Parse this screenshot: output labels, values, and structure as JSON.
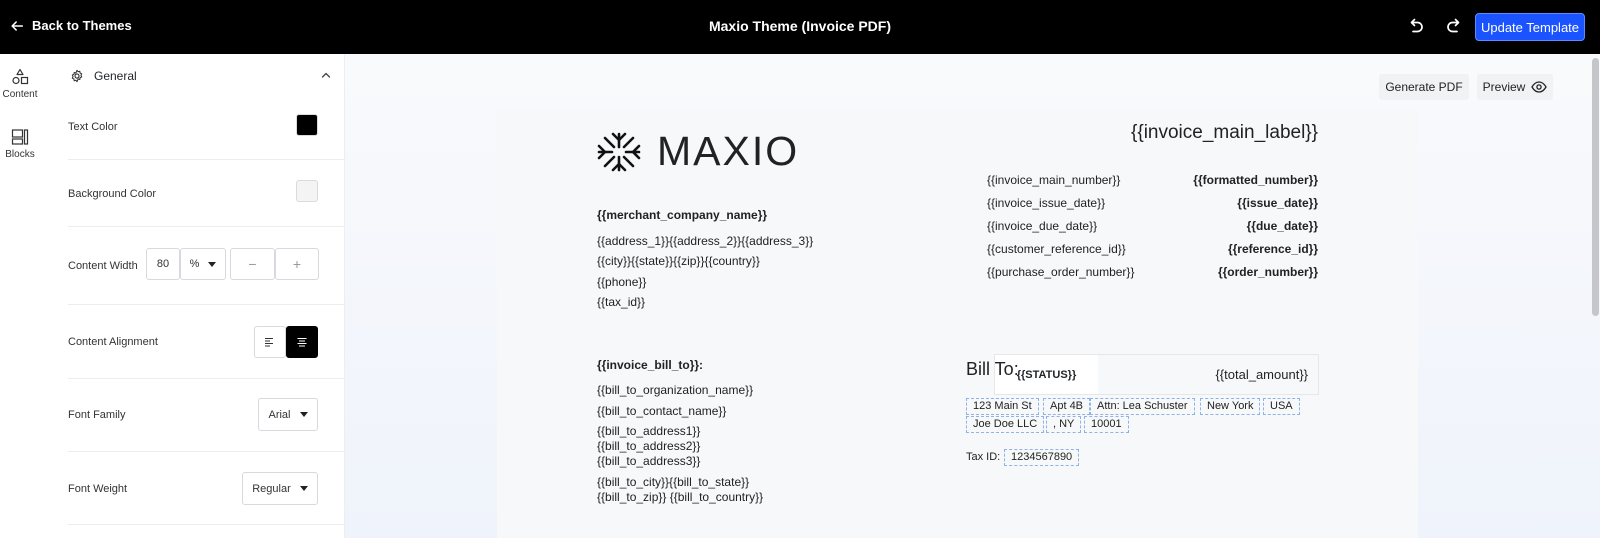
{
  "topbar": {
    "back_label": "Back to Themes",
    "title": "Maxio Theme (Invoice PDF)",
    "update_label": "Update Template"
  },
  "rail": {
    "items": [
      {
        "label": "Content",
        "icon": "shapes-icon"
      },
      {
        "label": "Blocks",
        "icon": "blocks-icon"
      }
    ]
  },
  "panel": {
    "section_title": "General",
    "text_color": {
      "label": "Text Color",
      "value": "#000000"
    },
    "background_color": {
      "label": "Background Color",
      "value": "#f4f4f5"
    },
    "content_width": {
      "label": "Content Width",
      "value": "80",
      "unit": "%",
      "minus": "−",
      "plus": "+"
    },
    "content_alignment": {
      "label": "Content Alignment",
      "selected": "center"
    },
    "font_family": {
      "label": "Font Family",
      "value": "Arial"
    },
    "font_weight": {
      "label": "Font Weight",
      "value": "Regular"
    }
  },
  "canvas": {
    "generate_label": "Generate PDF",
    "preview_label": "Preview"
  },
  "invoice": {
    "logo_text": "MAXIO",
    "main_label": "{{invoice_main_label}}",
    "meta": [
      {
        "label": "{{invoice_main_number}}",
        "value": "{{formatted_number}}"
      },
      {
        "label": "{{invoice_issue_date}}",
        "value": "{{issue_date}}"
      },
      {
        "label": "{{invoice_due_date}}",
        "value": "{{due_date}}"
      },
      {
        "label": "{{customer_reference_id}}",
        "value": "{{reference_id}}"
      },
      {
        "label": "{{purchase_order_number}}",
        "value": "{{order_number}}"
      }
    ],
    "status": "{{STATUS}}",
    "total": "{{total_amount}}",
    "merchant": {
      "name": "{{merchant_company_name}}",
      "lines": [
        "{{address_1}}{{address_2}}{{address_3}}",
        "{{city}}{{state}}{{zip}}{{country}}",
        "{{phone}}",
        "{{tax_id}}"
      ]
    },
    "bill_to_heading": "{{invoice_bill_to}}:",
    "bill_to_lines": [
      "{{bill_to_organization_name}}",
      "{{bill_to_contact_name}}",
      "{{bill_to_address1}}",
      "{{bill_to_address2}}",
      "{{bill_to_address3}}",
      "{{bill_to_city}}{{bill_to_state}}",
      "{{bill_to_zip}} {{bill_to_country}}"
    ],
    "preview_bill_to": {
      "title": "Bill To:",
      "row1": [
        "123 Main St",
        "Apt 4B",
        "Attn: Lea Schuster",
        "New York",
        "USA"
      ],
      "row2": [
        "Joe Doe LLC",
        ", NY",
        "10001"
      ],
      "tax_label": "Tax ID:",
      "tax_value": "1234567890"
    }
  }
}
